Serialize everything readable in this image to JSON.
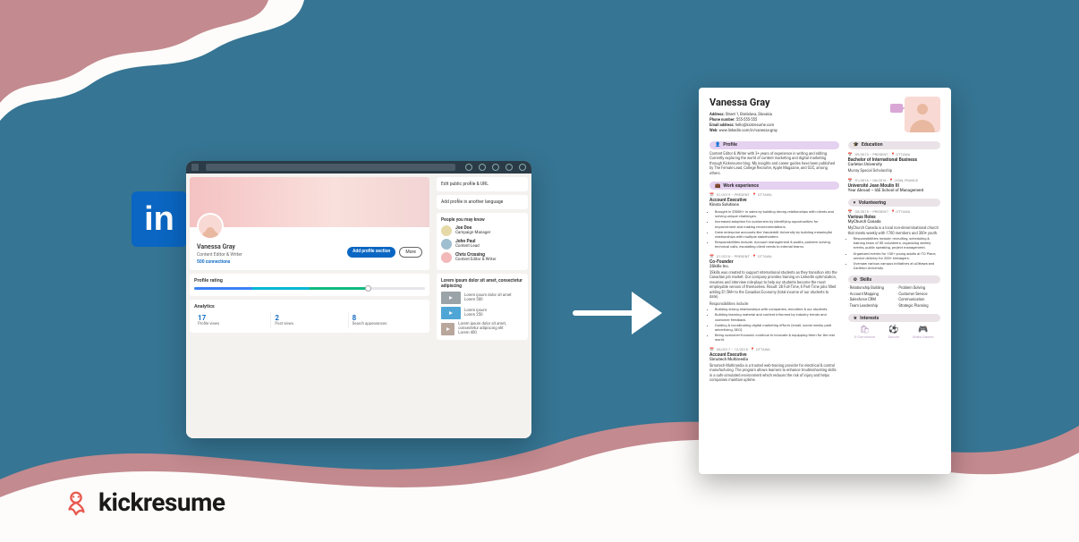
{
  "brand": {
    "name": "kickresume"
  },
  "linkedin": {
    "profile": {
      "name": "Vanessa Gray",
      "subtitle": "Content Editor & Writer",
      "connections": "500 connections",
      "add_section_label": "Add profile section",
      "more_label": "More"
    },
    "rating_card": {
      "title": "Profile rating"
    },
    "analytics": {
      "title": "Analytics",
      "items": [
        {
          "num": "17",
          "label": "Profile views"
        },
        {
          "num": "2",
          "label": "Post views"
        },
        {
          "num": "8",
          "label": "Search appearances"
        }
      ]
    },
    "aside": {
      "edit_label": "Edit public profile & URL",
      "lang_label": "Add profile in another language",
      "pymk_title": "People you may know",
      "pymk": [
        {
          "name": "Joe Doe",
          "role": "Campaign Manager",
          "color": "#e6d9a8"
        },
        {
          "name": "John Paul",
          "role": "Content Lead",
          "color": "#9fbecf"
        },
        {
          "name": "Chris Crossing",
          "role": "Content Editor & Writer",
          "color": "#f3b9b9"
        }
      ],
      "videos_title": "Lorem ipsum dolor sit amet, consectetur adipiscing",
      "videos": [
        {
          "title": "Lorem ipsum dolor sit amet",
          "sub": "Lorem 500",
          "color": "#9aa3a8"
        },
        {
          "title": "Lorem ipsum",
          "sub": "Lorem 250",
          "color": "#4fa6d6"
        },
        {
          "title": "Lorem ipsum dolor sit amet, consectetur adipiscing elit",
          "sub": "Lorem 400",
          "color": "#b9a79c"
        }
      ]
    }
  },
  "resume": {
    "name": "Vanessa Gray",
    "contact": {
      "address_label": "Address:",
      "address": "Street 1, Bratislava, Slovakia",
      "phone_label": "Phone number:",
      "phone": "555-555-555",
      "email_label": "Email address:",
      "email": "hello@kickresume.com",
      "web_label": "Web:",
      "web": "www.linkedin.com/in/vanessa-gray"
    },
    "profile": {
      "title": "Profile",
      "text": "Content Editor & Writer with 3+ years of experience in writing and editing. Currently exploring the world of content marketing and digital marketing through Kickresume blog. My insights and career guides have been published by The Female Lead, College Recruiter, Apple Magazine, and G2C, among others."
    },
    "work": {
      "title": "Work experience",
      "items": [
        {
          "dates": "01/2019 – PRESENT  ·  📍 OTTAWA",
          "role": "Account Executive",
          "company": "Kinsta Solutions",
          "bullets": [
            "Brought in $500K+ in sales by building strong relationships with clients and solving unique challenges.",
            "Increased adoption for customers by identifying opportunities for improvement and making recommendations.",
            "Grew enterprise accounts like Vanderbilt University by building meaningful relationships with multiple stakeholders.",
            "Responsibilities include: Account management & audits, problem solving, technical calls, escalating client needs to internal teams."
          ]
        },
        {
          "dates": "01/2018 – PRESENT  ·  📍 OTTAWA",
          "role": "Co-Founder",
          "company": "3Skills Inc.",
          "desc": "3Skills was created to support international students as they transition into the Canadian job market. Our company provides training on LinkedIn optimization, resumes and interview role-plays to help our students become the most employable version of themselves. Result: 28 Full-Time, 6 Part-Time jobs filled adding $1.5M+ to the Canadian Economy (total income of our students to date).",
          "resp_title": "Responsibilities include:",
          "bullets": [
            "Building strong relationships with companies, recruiters & our students.",
            "Building learning material and content informed by industry trends and customer feedback.",
            "Guiding & coordinating digital marketing efforts (email, social media, paid advertising, SEO).",
            "Being customer-focused: continue to innovate & equipping them for the real world."
          ]
        },
        {
          "dates": "08/2017 – 12/2018  ·  📍 OTTAWA",
          "role": "Account Executive",
          "company": "Simutech Multimedia",
          "desc": "Simutech Multimedia is a trusted web-training provider for electrical & control manufacturing. The program allows learners to enhance troubleshooting skills in a safe simulated environment which reduces the risk of injury and helps companies maintain uptime."
        }
      ]
    },
    "education": {
      "title": "Education",
      "items": [
        {
          "dates": "09/2013 – PRESENT  ·  📍 OTTAWA",
          "role": "Bachelor of International Business",
          "company": "Carleton University",
          "note": "Murray Special Scholarship"
        },
        {
          "dates": "01/2016 – 06/2016  ·  📍 LYON, FRANCE",
          "role": "Université Jean Moulin III",
          "company": "Year Abroad – IAE School of Management"
        }
      ]
    },
    "volunteering": {
      "title": "Volunteering",
      "items": [
        {
          "dates": "05/2015 – PRESENT  ·  📍 OTTAWA",
          "role": "Various Roles",
          "company": "MyChurch Canada",
          "desc": "MyChurch Canada is a local non-denominational church that meets weekly with 1700 members and 300+ youth.",
          "bullets": [
            "Responsibilities include: recruiting, scheduling & training team of 50 volunteers, organizing weekly events, public speaking, project management.",
            "Organized events for 100+ young adults at TD Place, service delivery for 200+ teenagers.",
            "Oversaw various campus initiatives at uOttawa and Carleton University."
          ]
        }
      ]
    },
    "skills": {
      "title": "Skills",
      "items": [
        "Relationship Building",
        "Problem Solving",
        "Account Mapping",
        "Customer Service",
        "Salesforce CRM",
        "Communication",
        "Team Leadership",
        "Strategic Planning"
      ]
    },
    "interests": {
      "title": "Interests",
      "items": [
        {
          "icon": "🛍",
          "label": "E-Commerce"
        },
        {
          "icon": "⚽",
          "label": "Soccer"
        },
        {
          "icon": "🎮",
          "label": "Video Games"
        }
      ]
    }
  }
}
